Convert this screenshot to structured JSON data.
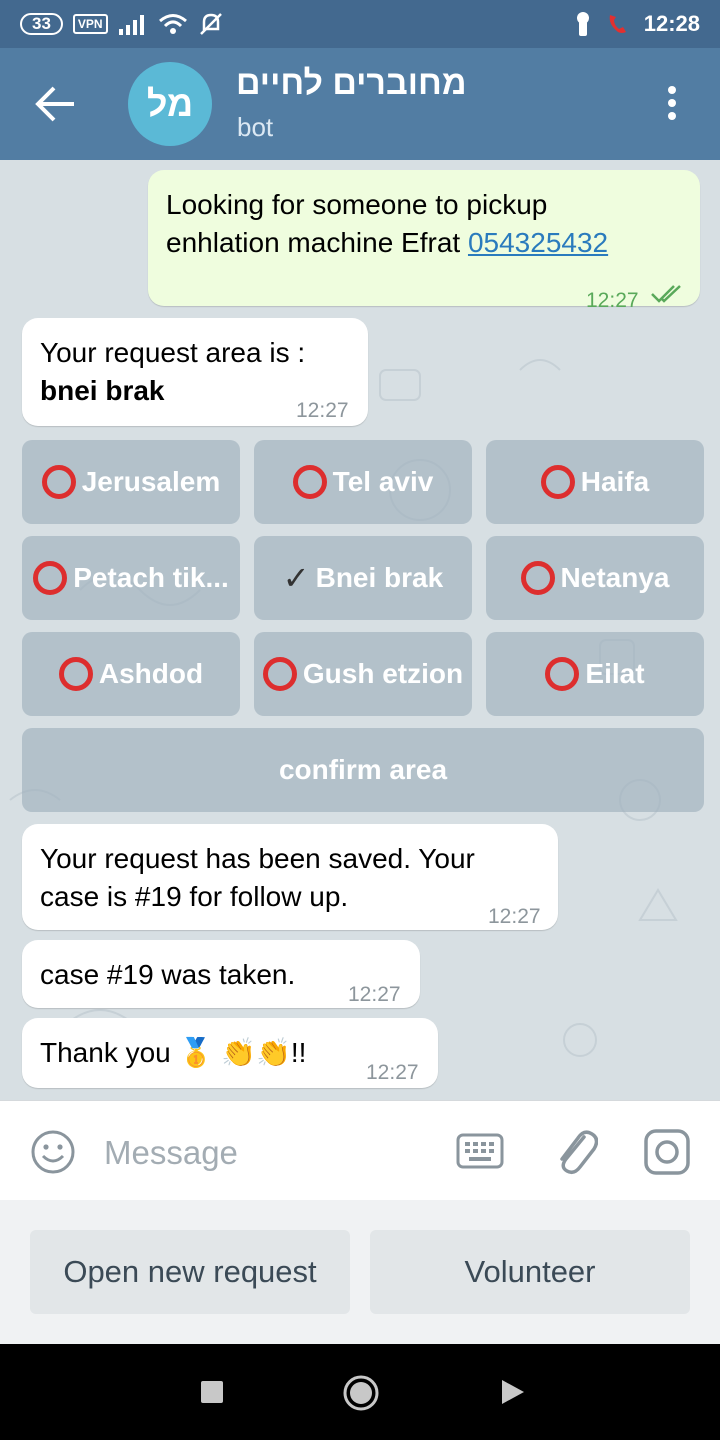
{
  "status_bar": {
    "badge_count": "33",
    "vpn": "VPN",
    "time": "12:28",
    "icons": [
      "signal-icon",
      "wifi-icon",
      "mute-icon",
      "key-icon",
      "call-icon"
    ]
  },
  "header": {
    "avatar_initials": "מל",
    "title": "מחוברים לחיים",
    "subtitle": "bot"
  },
  "messages": {
    "m1": {
      "line1": "Looking for someone to pickup",
      "line2": "enhlation machine  Efrat ",
      "link": "054325432",
      "time": "12:27"
    },
    "m2": {
      "line1": "Your request area is :",
      "line2": "bnei brak",
      "time": "12:27"
    },
    "m3": {
      "line1": "Your request has been saved. Your",
      "line2": "case is #19 for follow up.",
      "time": "12:27"
    },
    "m4": {
      "text": "case #19 was taken.",
      "time": "12:27"
    },
    "m5": {
      "text": "Thank you 🥇 👏👏!!",
      "time": "12:27"
    }
  },
  "area_keyboard": {
    "jerusalem": "Jerusalem",
    "telaviv": "Tel aviv",
    "haifa": "Haifa",
    "petach": "Petach tik...",
    "bneibrak": "Bnei brak",
    "netanya": "Netanya",
    "ashdod": "Ashdod",
    "gush": "Gush etzion",
    "eilat": "Eilat",
    "confirm": "confirm area",
    "selected": "Bnei brak"
  },
  "input": {
    "placeholder": "Message"
  },
  "bottom_keyboard": {
    "open_request": "Open new request",
    "volunteer": "Volunteer"
  },
  "colors": {
    "header": "#527da3",
    "status_bar": "#43698f",
    "outgoing_bubble": "#effdde",
    "chat_bg": "#d7dfe3",
    "ring_red": "#dd2e2e"
  }
}
